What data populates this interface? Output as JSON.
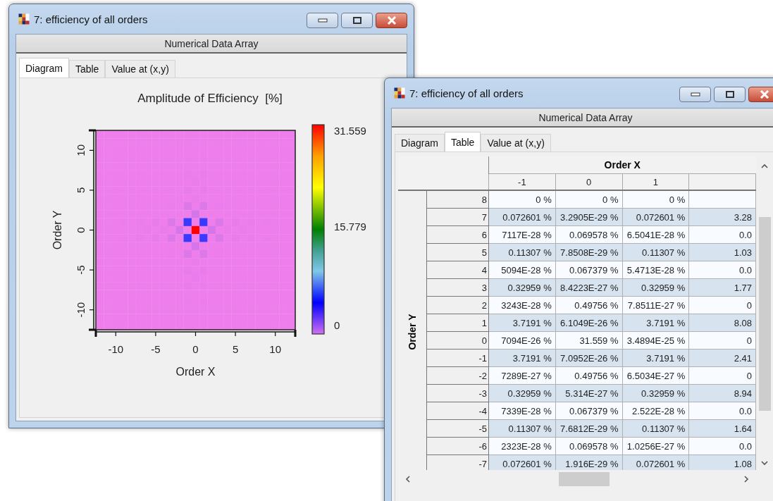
{
  "windows": [
    {
      "kind": "diagram",
      "title": "7: efficiency of all orders",
      "subtitle": "Numerical Data Array",
      "tabs": [
        {
          "label": "Diagram",
          "selected": true
        },
        {
          "label": "Table",
          "selected": false
        },
        {
          "label": "Value at (x,y)",
          "selected": false
        }
      ],
      "diagram": {
        "title": "Amplitude of Efficiency  [%]",
        "xlabel": "Order X",
        "ylabel": "Order Y",
        "xticks": [
          "-10",
          "-5",
          "0",
          "5",
          "10"
        ],
        "yticks": [
          "10",
          "5",
          "0",
          "-5",
          "-10"
        ],
        "colorbar_labels": [
          "31.559",
          "15.779",
          "0"
        ]
      }
    },
    {
      "kind": "table",
      "title": "7: efficiency of all orders",
      "subtitle": "Numerical Data Array",
      "tabs": [
        {
          "label": "Diagram",
          "selected": false
        },
        {
          "label": "Table",
          "selected": true
        },
        {
          "label": "Value at (x,y)",
          "selected": false
        }
      ],
      "table": {
        "column_group": "Order X",
        "row_group": "Order Y",
        "columns": [
          "-1",
          "0",
          "1"
        ],
        "rows": [
          {
            "label": "8",
            "cells": [
              "0 %",
              "0 %",
              "0 %"
            ]
          },
          {
            "label": "7",
            "cells": [
              "0.072601 %",
              "3.2905E-29 %",
              "0.072601 %",
              "3.28"
            ]
          },
          {
            "label": "6",
            "cells": [
              "7117E-28 %",
              "0.069578 %",
              "6.5041E-28 %",
              "0.0"
            ]
          },
          {
            "label": "5",
            "cells": [
              "0.11307 %",
              "7.8508E-29 %",
              "0.11307 %",
              "1.03"
            ]
          },
          {
            "label": "4",
            "cells": [
              "5094E-28 %",
              "0.067379 %",
              "5.4713E-28 %",
              "0.0"
            ]
          },
          {
            "label": "3",
            "cells": [
              "0.32959 %",
              "8.4223E-27 %",
              "0.32959 %",
              "1.77"
            ]
          },
          {
            "label": "2",
            "cells": [
              "3243E-28 %",
              "0.49756 %",
              "7.8511E-27 %",
              "0"
            ]
          },
          {
            "label": "1",
            "cells": [
              "3.7191 %",
              "6.1049E-26 %",
              "3.7191 %",
              "8.08"
            ]
          },
          {
            "label": "0",
            "cells": [
              "7094E-26 %",
              "31.559 %",
              "3.4894E-25 %",
              "0"
            ]
          },
          {
            "label": "-1",
            "cells": [
              "3.7191 %",
              "7.0952E-26 %",
              "3.7191 %",
              "2.41"
            ]
          },
          {
            "label": "-2",
            "cells": [
              "7289E-27 %",
              "0.49756 %",
              "6.5034E-27 %",
              "0"
            ]
          },
          {
            "label": "-3",
            "cells": [
              "0.32959 %",
              "5.314E-27 %",
              "0.32959 %",
              "8.94"
            ]
          },
          {
            "label": "-4",
            "cells": [
              "7339E-28 %",
              "0.067379 %",
              "2.522E-28 %",
              "0.0"
            ]
          },
          {
            "label": "-5",
            "cells": [
              "0.11307 %",
              "7.6812E-29 %",
              "0.11307 %",
              "1.64"
            ]
          },
          {
            "label": "-6",
            "cells": [
              "2323E-28 %",
              "0.069578 %",
              "1.0256E-27 %",
              "0.0"
            ]
          },
          {
            "label": "-7",
            "cells": [
              "0.072601 %",
              "1.916E-29 %",
              "0.072601 %",
              "1.08"
            ]
          }
        ]
      }
    }
  ]
}
